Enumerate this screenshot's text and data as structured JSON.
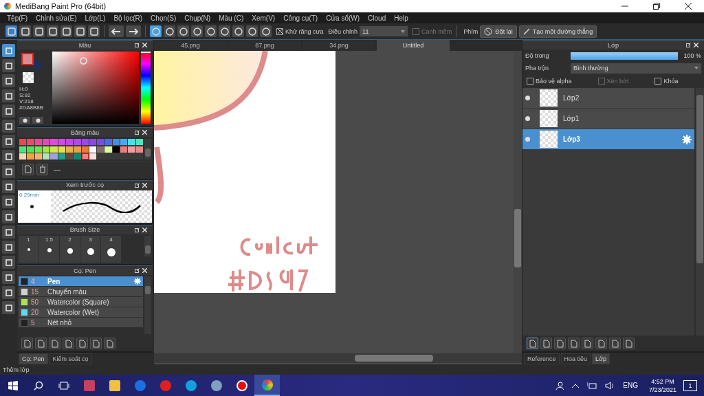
{
  "window": {
    "title": "MediBang Paint Pro (64bit)"
  },
  "menu": [
    "Tệp(F)",
    "Chỉnh sửa(E)",
    "Lớp(L)",
    "Bộ lọc(R)",
    "Chọn(S)",
    "Chụp(N)",
    "Màu (C)",
    "Xem(V)",
    "Công cụ(T)",
    "Cửa sổ(W)",
    "Cloud",
    "Help"
  ],
  "toolbar": {
    "snap_buttons": [
      {
        "selected": true
      },
      {
        "selected": false
      },
      {
        "selected": false
      },
      {
        "selected": false
      },
      {
        "selected": false
      },
      {
        "selected": false
      },
      {
        "selected": false
      },
      {
        "selected": false
      },
      {
        "selected": false
      }
    ],
    "antialias": {
      "label": "Khử răng cưa",
      "checked": true
    },
    "adjust": {
      "label": "Điều chỉnh",
      "value": "11"
    },
    "soft_edge": {
      "label": "Canh mềm",
      "checked": false,
      "disabled": true
    },
    "keys_label": "Phím",
    "reset_button": "Đặt lại",
    "line_button": "Tạo một đường thẳng"
  },
  "tools": [
    {
      "selected": true
    },
    {
      "selected": false
    },
    {
      "selected": false
    },
    {
      "selected": false
    },
    {
      "selected": false
    },
    {
      "selected": false
    },
    {
      "selected": false
    },
    {
      "selected": false
    },
    {
      "selected": false
    },
    {
      "selected": false
    },
    {
      "selected": false
    },
    {
      "selected": false
    },
    {
      "selected": false
    },
    {
      "selected": false
    },
    {
      "selected": false
    },
    {
      "selected": false
    },
    {
      "selected": false
    },
    {
      "selected": false
    }
  ],
  "color_panel": {
    "title": "Màu",
    "swatches": [
      {
        "kind": "foreground",
        "color": "#da8b8b"
      },
      {
        "kind": "background",
        "color": "#1e2e5e"
      }
    ],
    "readout": [
      "H:0",
      "S:92",
      "V:218",
      "#DA8B8B"
    ],
    "hue_slider": {
      "level": 0
    }
  },
  "palette_panel": {
    "title": "Bảng màu",
    "name": "---",
    "colors": [
      {
        "color": "#e84a4a",
        "selected": false
      },
      {
        "color": "#e84a6a",
        "selected": false
      },
      {
        "color": "#e84a9a",
        "selected": false
      },
      {
        "color": "#e04ac0",
        "selected": false
      },
      {
        "color": "#e04ae0",
        "selected": false
      },
      {
        "color": "#d04ae8",
        "selected": false
      },
      {
        "color": "#c04ae8",
        "selected": false
      },
      {
        "color": "#b04ae8",
        "selected": false
      },
      {
        "color": "#9a4ae8",
        "selected": false
      },
      {
        "color": "#8a4ae8",
        "selected": false
      },
      {
        "color": "#7a4ae8",
        "selected": false
      },
      {
        "color": "#4a6ae8",
        "selected": false
      },
      {
        "color": "#4a8ae8",
        "selected": false
      },
      {
        "color": "#4aaae8",
        "selected": false
      },
      {
        "color": "#4ae0e8",
        "selected": false
      },
      {
        "color": "#4ae8c0",
        "selected": false
      },
      {
        "color": "#4ae87a",
        "selected": false
      },
      {
        "color": "#4ae84a",
        "selected": false
      },
      {
        "color": "#6ae84a",
        "selected": false
      },
      {
        "color": "#a0e84a",
        "selected": false
      },
      {
        "color": "#d0e84a",
        "selected": false
      },
      {
        "color": "#e8e04a",
        "selected": false
      },
      {
        "color": "#e8b04a",
        "selected": false
      },
      {
        "color": "#e8a04a",
        "selected": false
      },
      {
        "color": "#e87a3a",
        "selected": false
      },
      {
        "color": "#ffffff",
        "selected": false
      },
      {
        "color": "#8a6a6a",
        "selected": false
      },
      {
        "color": "#e0f8a0",
        "selected": false
      },
      {
        "color": "#000000",
        "selected": false
      },
      {
        "color": "#e87a7a",
        "selected": false
      },
      {
        "color": "#e8a0a0",
        "selected": false
      },
      {
        "color": "#e88a8a",
        "selected": false
      },
      {
        "color": "#fcd8b0",
        "selected": false
      },
      {
        "color": "#f8a040",
        "selected": false
      },
      {
        "color": "#f8b070",
        "selected": false
      },
      {
        "color": "#b8e0b0",
        "selected": false
      },
      {
        "color": "#a0a0e0",
        "selected": false
      },
      {
        "color": "#20a090",
        "selected": false
      },
      {
        "color": "#604840",
        "selected": false
      },
      {
        "color": "#108870",
        "selected": false
      },
      {
        "color": "#da8b8b",
        "selected": true
      },
      {
        "color": "#fce0e0",
        "selected": false
      }
    ]
  },
  "preview_panel": {
    "title": "Xem trước cọ",
    "size": "0.29mm"
  },
  "size_panel": {
    "title": "Brush Size",
    "sizes": [
      "1",
      "1.5",
      "2",
      "3",
      "4"
    ]
  },
  "brush_panel": {
    "title": "Cọ: Pen",
    "brushes": [
      {
        "color": "#222222",
        "size": "4",
        "name": "Pen",
        "selected": true
      },
      {
        "color": "#d0d0d0",
        "size": "15",
        "name": "Chuyển màu",
        "selected": false
      },
      {
        "color": "#b0e050",
        "size": "50",
        "name": "Watercolor (Square)",
        "selected": false
      },
      {
        "color": "#60d8f0",
        "size": "20",
        "name": "Watercolor (Wet)",
        "selected": false
      },
      {
        "color": "#222222",
        "size": "5",
        "name": "Nét nhỏ",
        "selected": false
      }
    ]
  },
  "left_tabs": [
    {
      "label": "Cọ: Pen",
      "selected": true
    },
    {
      "label": "Kiểm soát cọ",
      "selected": false
    }
  ],
  "document_tabs": [
    {
      "label": "45.png",
      "selected": false
    },
    {
      "label": "87.png",
      "selected": false
    },
    {
      "label": "34.png",
      "selected": false
    },
    {
      "label": "Untitled",
      "selected": true
    }
  ],
  "layer_panel": {
    "title": "Lớp",
    "opacity_label": "Độ trong",
    "opacity": {
      "level": 1.0
    },
    "opacity_reading": "100 %",
    "blend_label": "Pha trộn",
    "blend_value": "Bình thường",
    "options": [
      {
        "label": "Bảo vệ alpha",
        "checked": false,
        "disabled": false
      },
      {
        "label": "Xén bớt",
        "checked": false,
        "disabled": true
      },
      {
        "label": "Khóa",
        "checked": false,
        "disabled": false
      }
    ],
    "layers": [
      {
        "name": "Lớp2",
        "visible": true,
        "selected": false
      },
      {
        "name": "Lớp1",
        "visible": true,
        "selected": false
      },
      {
        "name": "Lớp3",
        "visible": true,
        "selected": true
      }
    ]
  },
  "right_tabs": [
    {
      "label": "Reference",
      "selected": false
    },
    {
      "label": "Hoa tiêu",
      "selected": false
    },
    {
      "label": "Lớp",
      "selected": true
    }
  ],
  "status_bar": "Thêm lớp",
  "taskbar": {
    "language": "ENG",
    "time": "4:52 PM",
    "date": "7/23/2021",
    "notifications": "1"
  }
}
